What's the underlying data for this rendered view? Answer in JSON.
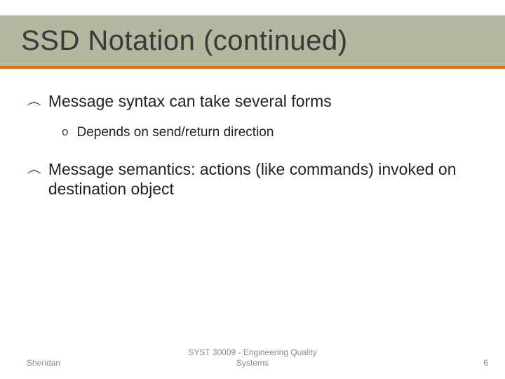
{
  "title": "SSD Notation (continued)",
  "bullets": [
    {
      "level": 1,
      "text": "Message syntax can take several forms"
    },
    {
      "level": 2,
      "text": "Depends on send/return direction"
    },
    {
      "level": 1,
      "text": "Message semantics: actions (like commands) invoked on destination object"
    }
  ],
  "footer": {
    "left": "Sheridan",
    "center": "SYST 30009 - Engineering Quality\nSystems",
    "right": "6"
  },
  "markers": {
    "level1": "෴",
    "level2": "o"
  }
}
